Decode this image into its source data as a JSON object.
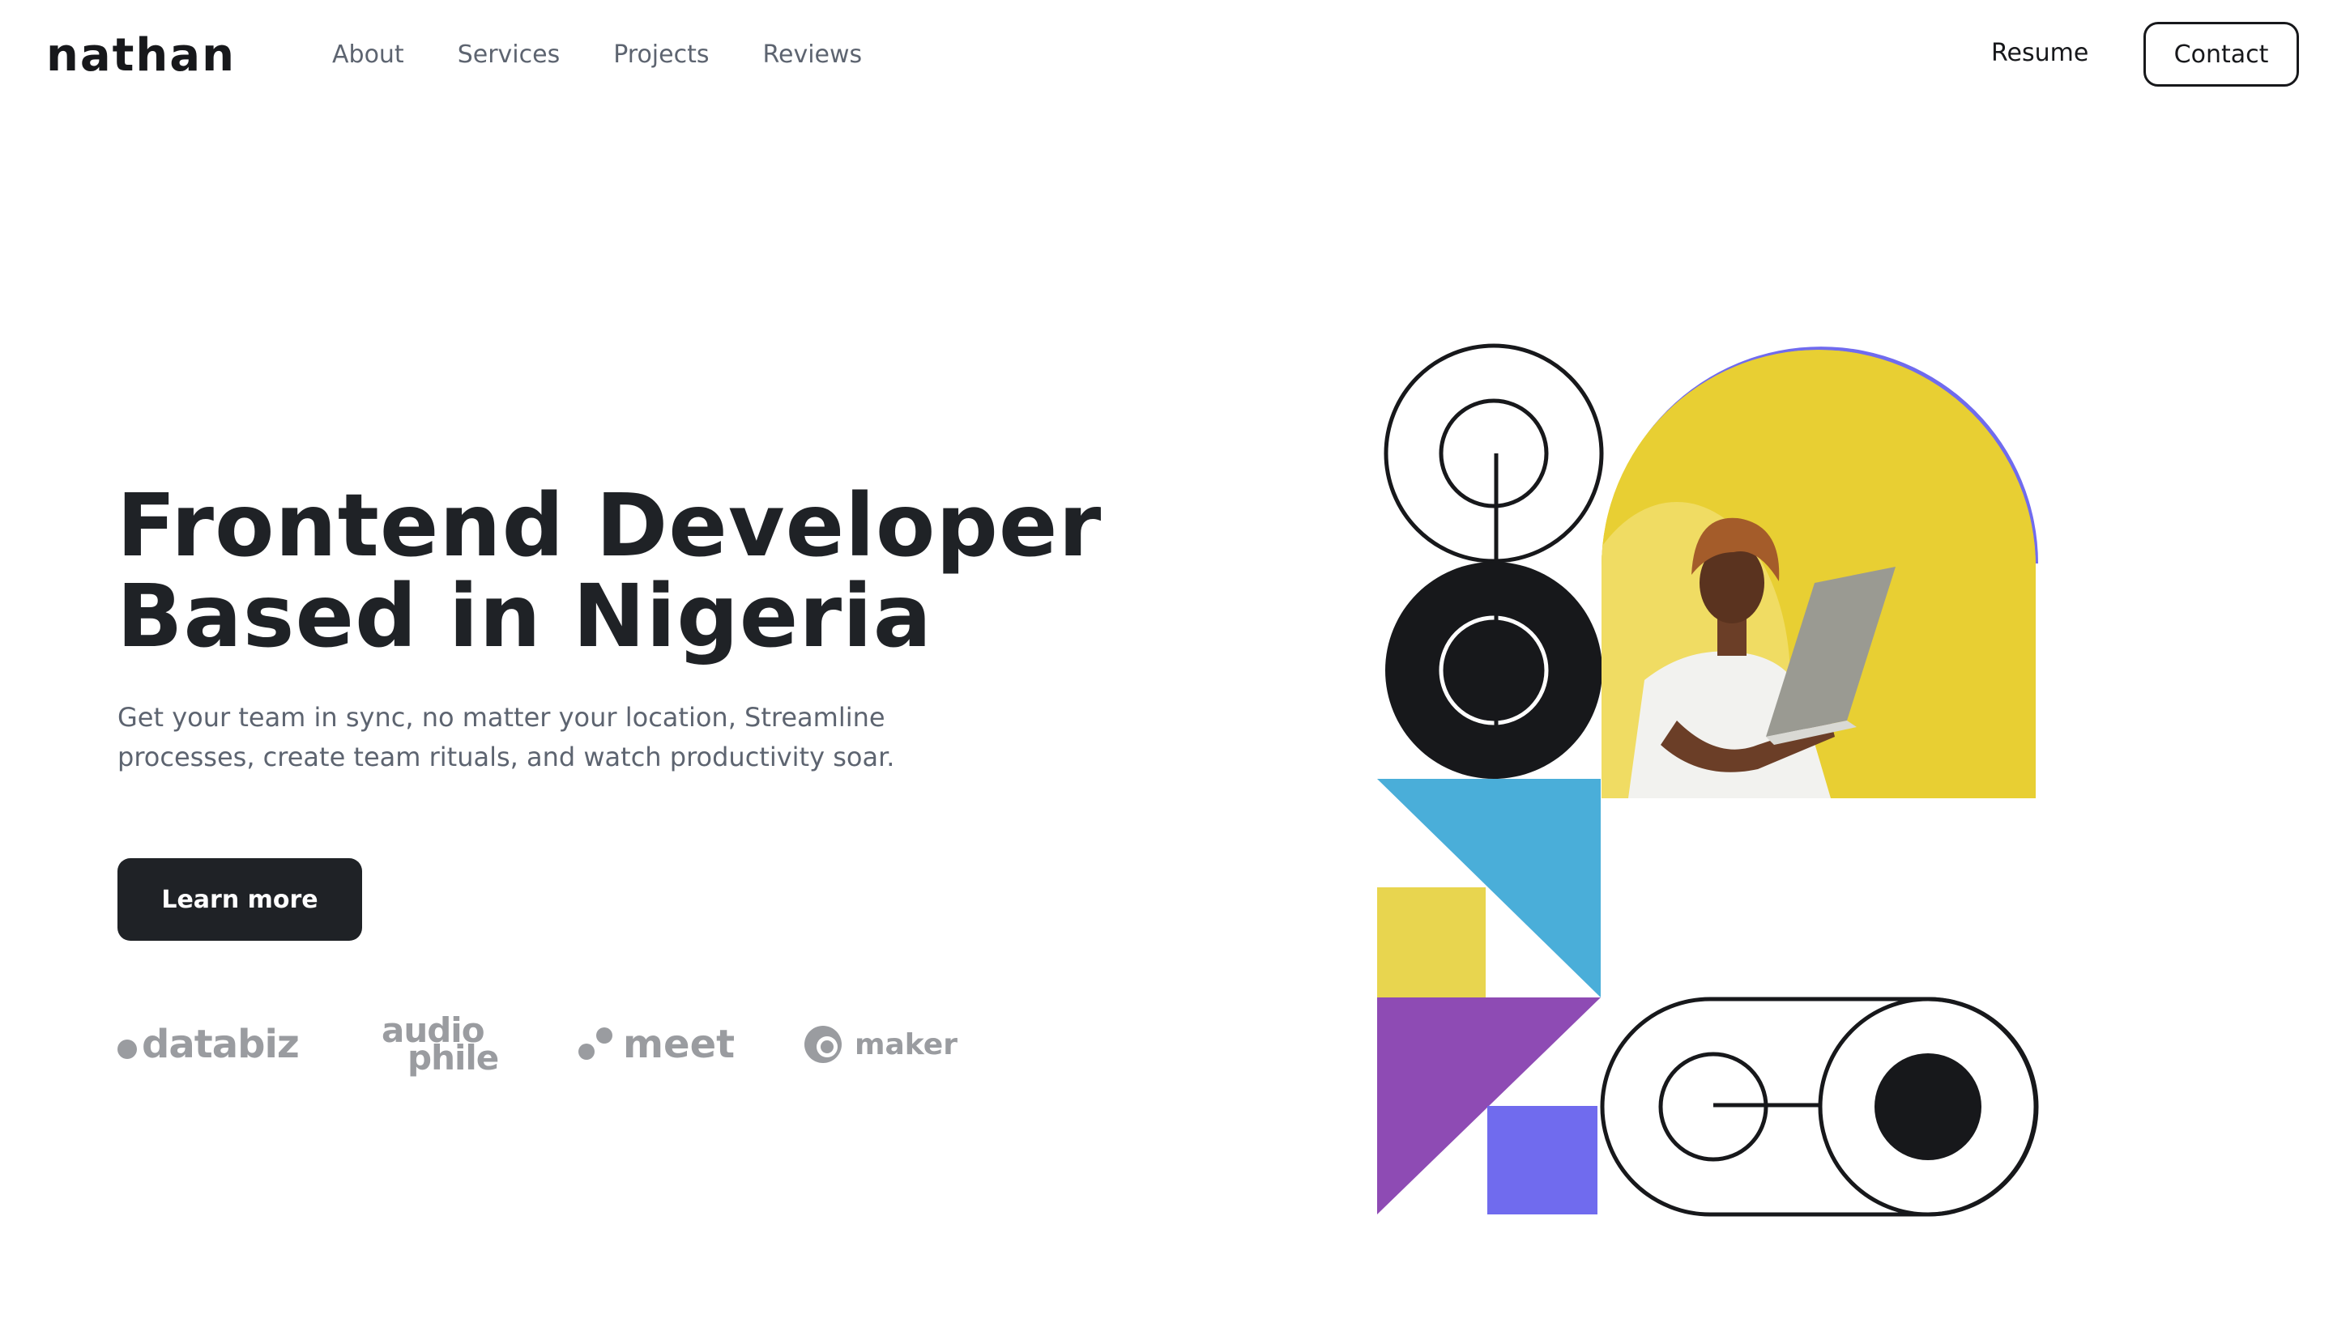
{
  "header": {
    "logo": "nathan",
    "nav": [
      {
        "label": "About"
      },
      {
        "label": "Services"
      },
      {
        "label": "Projects"
      },
      {
        "label": "Reviews"
      }
    ],
    "resume_label": "Resume",
    "contact_label": "Contact"
  },
  "hero": {
    "title_line1": "Frontend Developer",
    "title_line2": "Based in Nigeria",
    "subtitle": "Get your team in sync, no matter your location, Streamline processes, create team rituals, and watch productivity soar.",
    "cta_label": "Learn more"
  },
  "brands": {
    "databiz": "databiz",
    "audiophile_line1": "audio",
    "audiophile_line2": "phile",
    "meet": "meet",
    "maker": "maker"
  },
  "colors": {
    "dark": "#1f2226",
    "purple": "#706bee",
    "yellow": "#e7cf35",
    "cyan": "#4aaed9",
    "violet": "#8e4bb4",
    "mustard": "#e8d54f",
    "muted_text": "#5d6470",
    "logo_gray": "#9a9ca0"
  },
  "illustration": {
    "photo_alt": "developer-with-laptop"
  }
}
